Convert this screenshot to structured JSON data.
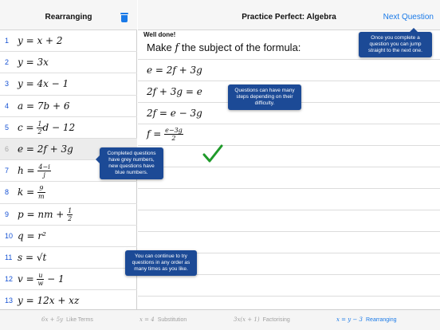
{
  "sidebar": {
    "title": "Rearranging",
    "questions": [
      {
        "num": "1",
        "expr": "y = x + 2",
        "completed": false
      },
      {
        "num": "2",
        "expr": "y = 3x",
        "completed": false
      },
      {
        "num": "3",
        "expr": "y = 4x − 1",
        "completed": false
      },
      {
        "num": "4",
        "expr": "a = 7b + 6",
        "completed": false
      },
      {
        "num": "5",
        "expr_pre": "c = ",
        "frac_num": "1",
        "frac_den": "2",
        "expr_post": "d − 12",
        "completed": false
      },
      {
        "num": "6",
        "expr": "e = 2f + 3g",
        "completed": true
      },
      {
        "num": "7",
        "expr_pre": "h = ",
        "frac_num": "4−i",
        "frac_den": "j",
        "expr_post": "",
        "completed": false
      },
      {
        "num": "8",
        "expr_pre": "k = ",
        "frac_num": "9",
        "frac_den": "m",
        "expr_post": "",
        "completed": false
      },
      {
        "num": "9",
        "expr_pre": "p = nm + ",
        "frac_num": "1",
        "frac_den": "2",
        "expr_post": "",
        "completed": false
      },
      {
        "num": "10",
        "expr": "q = r²",
        "completed": false
      },
      {
        "num": "11",
        "expr": "s = √t",
        "completed": false
      },
      {
        "num": "12",
        "expr_pre": "v = ",
        "frac_num": "u",
        "frac_den": "w",
        "expr_post": " − 1",
        "completed": false
      },
      {
        "num": "13",
        "expr": "y = 12x + xz",
        "completed": false
      }
    ]
  },
  "header": {
    "title": "Practice Perfect: Algebra",
    "next_label": "Next Question"
  },
  "work": {
    "feedback": "Well done!",
    "prompt_pre": "Make ",
    "prompt_var": "f",
    "prompt_post": " the subject of the formula:",
    "steps": [
      {
        "expr": "e = 2f + 3g"
      },
      {
        "expr": "2f + 3g = e"
      },
      {
        "expr": "2f = e − 3g"
      },
      {
        "expr_pre": "f = ",
        "frac_num": "e−3g",
        "frac_den": "2"
      }
    ]
  },
  "tooltips": {
    "next": "Once you complete a question you can jump straight to the next one.",
    "steps": "Questions can have many steps depending on their difficulty.",
    "completed": "Completed questions have grey numbers, new questions have blue numbers.",
    "order": "You can continue to try questions in any order as many times as you like."
  },
  "tabs": [
    {
      "math": "6x + 5y",
      "label": "Like Terms",
      "active": false
    },
    {
      "math": "x = 4",
      "label": "Substitution",
      "active": false
    },
    {
      "math": "3x(x + 1)",
      "label": "Factorising",
      "active": false
    },
    {
      "math": "x = y − 3",
      "label": "Rearranging",
      "active": true
    }
  ],
  "colors": {
    "accent": "#1a7ae8",
    "question_new": "#1753d4",
    "question_done": "#a8a8a8",
    "tooltip": "#1c4a96",
    "check": "#1f9a2a"
  },
  "icons": {
    "trash": "trash-icon",
    "check": "checkmark-icon"
  }
}
